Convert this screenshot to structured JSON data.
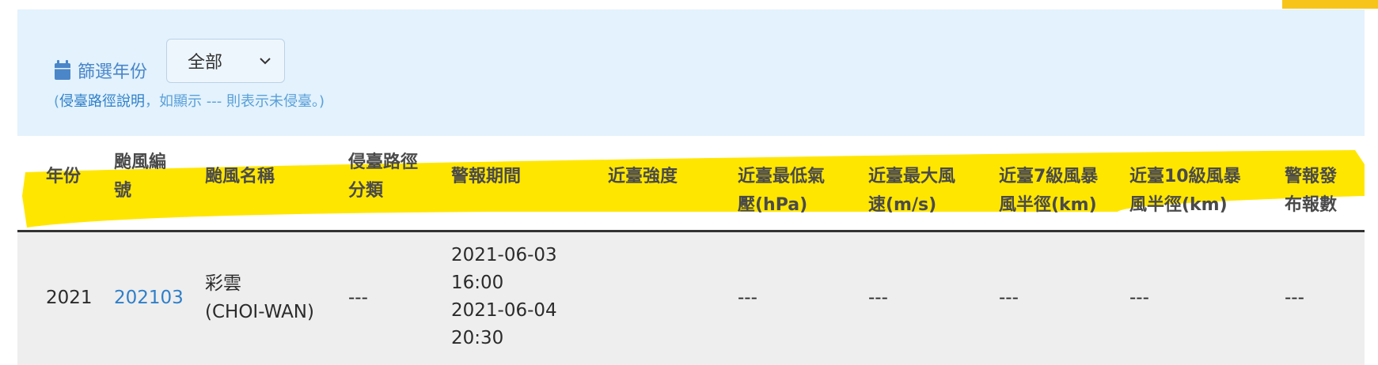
{
  "filter": {
    "label": "篩選年份",
    "selected_year": "全部",
    "note_prefix": "(",
    "note_link": "侵臺路徑說明",
    "note_rest": "，如顯示 --- 則表示未侵臺。)"
  },
  "table": {
    "headers": [
      [
        "年份"
      ],
      [
        "颱風編",
        "號"
      ],
      [
        "颱風名稱"
      ],
      [
        "侵臺路徑",
        "分類"
      ],
      [
        "警報期間"
      ],
      [
        "近臺強度"
      ],
      [
        "近臺最低氣",
        "壓(hPa)"
      ],
      [
        "近臺最大風",
        "速(m/s)"
      ],
      [
        "近臺7級風暴",
        "風半徑(km)"
      ],
      [
        "近臺10級風暴",
        "風半徑(km)"
      ],
      [
        "警報發",
        "布報數"
      ]
    ],
    "rows": [
      {
        "year": "2021",
        "typhoon_id": "202103",
        "name_zh": "彩雲",
        "name_en": "(CHOI-WAN)",
        "path_class": "---",
        "warning_start_date": "2021-06-03",
        "warning_start_time": "16:00",
        "warning_end_date": "2021-06-04",
        "warning_end_time": "20:30",
        "intensity": "",
        "min_pressure": "---",
        "max_wind": "---",
        "radius_7": "---",
        "radius_10": "---",
        "warning_count": "---"
      }
    ]
  },
  "colors": {
    "highlight": "#ffe600",
    "panel_bg": "#e3f2fd",
    "accent_blue": "#2f7fc9",
    "corner_accent": "#f7c41a"
  }
}
